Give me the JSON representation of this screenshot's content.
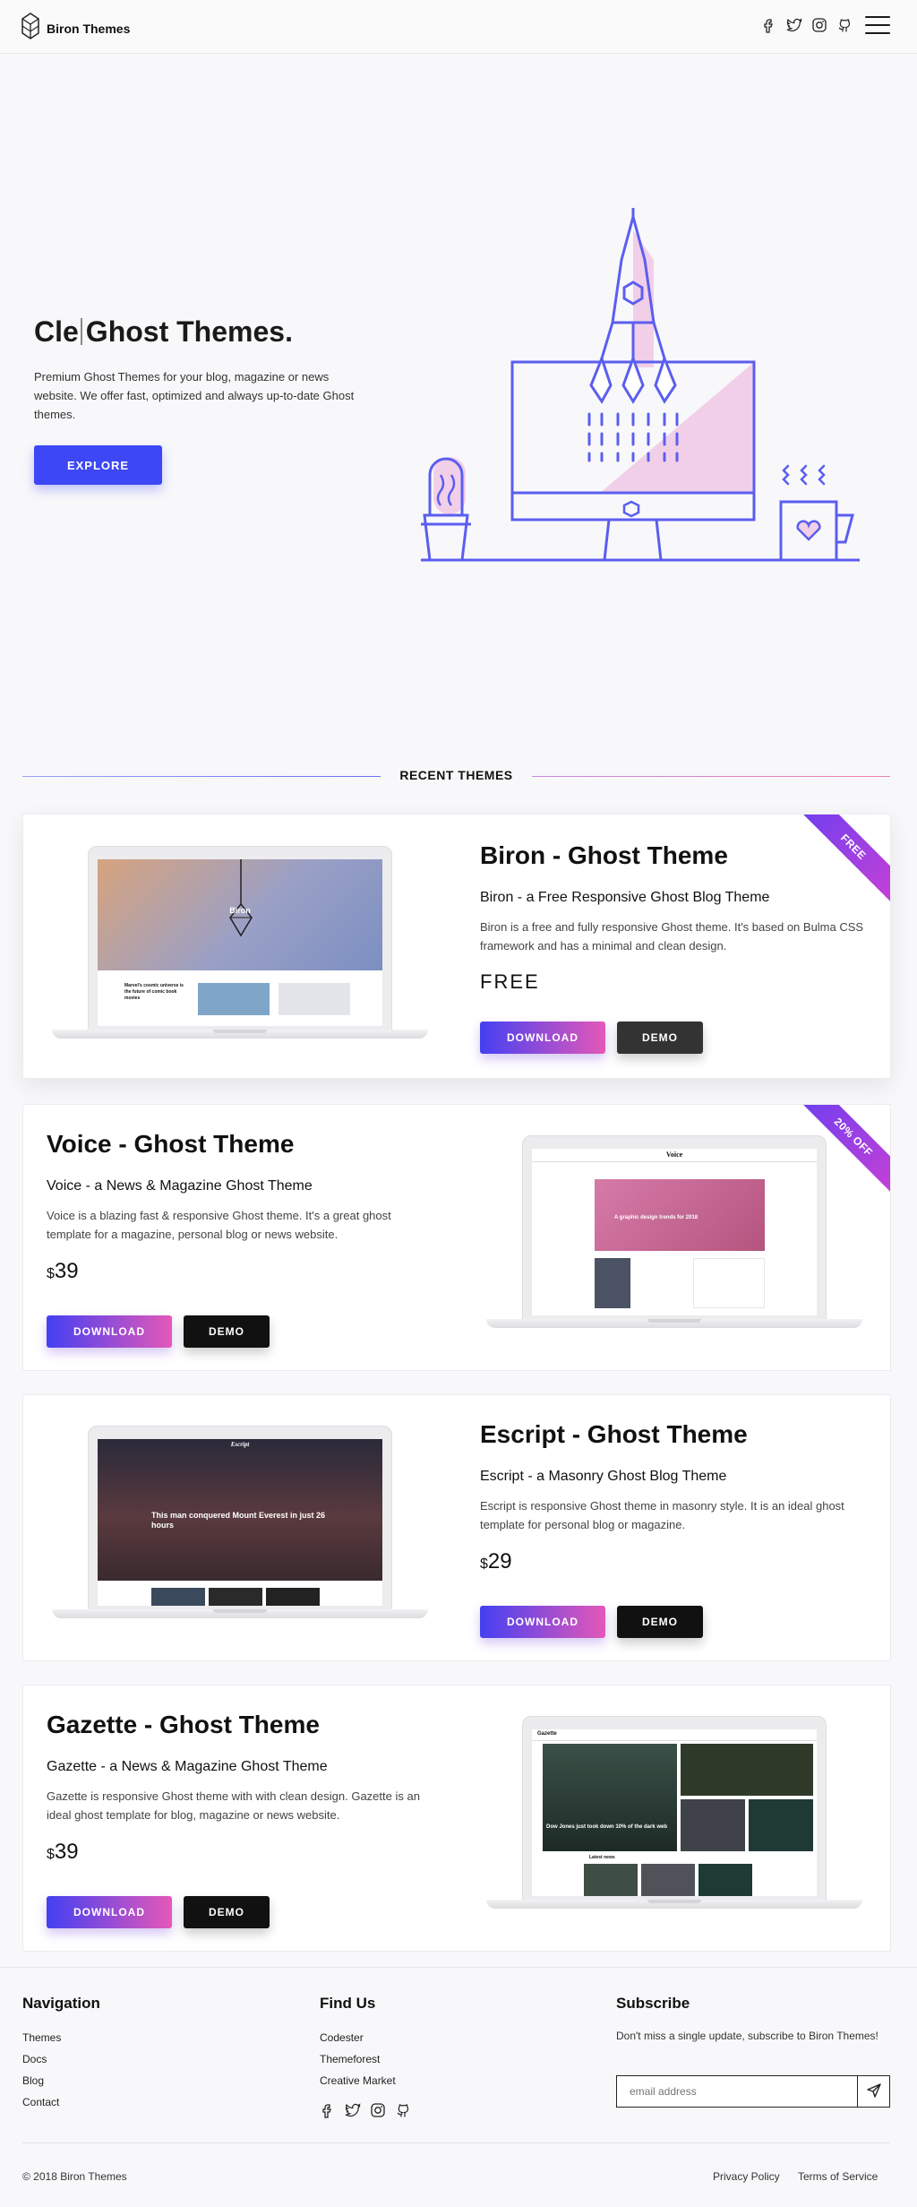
{
  "header": {
    "brand": "Biron Themes",
    "social_icons": [
      "facebook-icon",
      "twitter-icon",
      "instagram-icon",
      "github-icon"
    ],
    "menu_icon": "hamburger-menu-icon"
  },
  "hero": {
    "title_typed": "Cle",
    "title_rest": "Ghost Themes.",
    "description": "Premium Ghost Themes for your blog, magazine or news website. We offer fast, optimized and always up-to-date Ghost themes.",
    "cta_label": "EXPLORE"
  },
  "section": {
    "title": "RECENT THEMES"
  },
  "themes": [
    {
      "title": "Biron - Ghost Theme",
      "subtitle": "Biron - a Free Responsive Ghost Blog Theme",
      "description": "Biron is a free and fully responsive Ghost theme. It's based on Bulma CSS framework and has a minimal and clean design.",
      "price": "FREE",
      "ribbon": "FREE",
      "download_label": "DOWNLOAD",
      "demo_label": "DEMO",
      "screen_title": "Biron",
      "screen_post_title": "Marvel's cosmic universe is the future of comic book movies"
    },
    {
      "title": "Voice - Ghost Theme",
      "subtitle": "Voice - a News & Magazine Ghost Theme",
      "description": "Voice is a blazing fast & responsive Ghost theme. It's a great ghost template for a magazine, personal blog or news website.",
      "currency": "$",
      "price": "39",
      "ribbon": "20% OFF",
      "download_label": "DOWNLOAD",
      "demo_label": "DEMO",
      "screen_title": "Voice",
      "screen_post_title": "A graphic design trends for 2018"
    },
    {
      "title": "Escript - Ghost Theme",
      "subtitle": "Escript - a Masonry Ghost Blog Theme",
      "description": "Escript is responsive Ghost theme in masonry style. It is an ideal ghost template for personal blog or magazine.",
      "currency": "$",
      "price": "29",
      "download_label": "DOWNLOAD",
      "demo_label": "DEMO",
      "screen_title": "Escript",
      "screen_post_title": "This man conquered Mount Everest in just 26 hours"
    },
    {
      "title": "Gazette - Ghost Theme",
      "subtitle": "Gazette - a News & Magazine Ghost Theme",
      "description": "Gazette is responsive Ghost theme with with clean design. Gazette is an ideal ghost template for blog, magazine or news website.",
      "currency": "$",
      "price": "39",
      "download_label": "DOWNLOAD",
      "demo_label": "DEMO",
      "screen_title": "Gazette",
      "screen_post_title": "Dow Jones just took down 10% of the dark web",
      "screen_section": "Latest news"
    }
  ],
  "footer": {
    "navigation": {
      "title": "Navigation",
      "links": [
        "Themes",
        "Docs",
        "Blog",
        "Contact"
      ]
    },
    "find_us": {
      "title": "Find Us",
      "links": [
        "Codester",
        "Themeforest",
        "Creative Market"
      ]
    },
    "subscribe": {
      "title": "Subscribe",
      "text": "Don't miss a single update, subscribe to Biron Themes!",
      "placeholder": "email address"
    },
    "copyright": "© 2018 Biron Themes",
    "privacy": "Privacy Policy",
    "terms": "Terms of Service"
  },
  "colors": {
    "accent": "#3d47f5",
    "illustration": "#5b5ef0",
    "illustration_fill": "#f2cfe8",
    "gradient_start": "#4440f2",
    "gradient_end": "#e458b8"
  }
}
